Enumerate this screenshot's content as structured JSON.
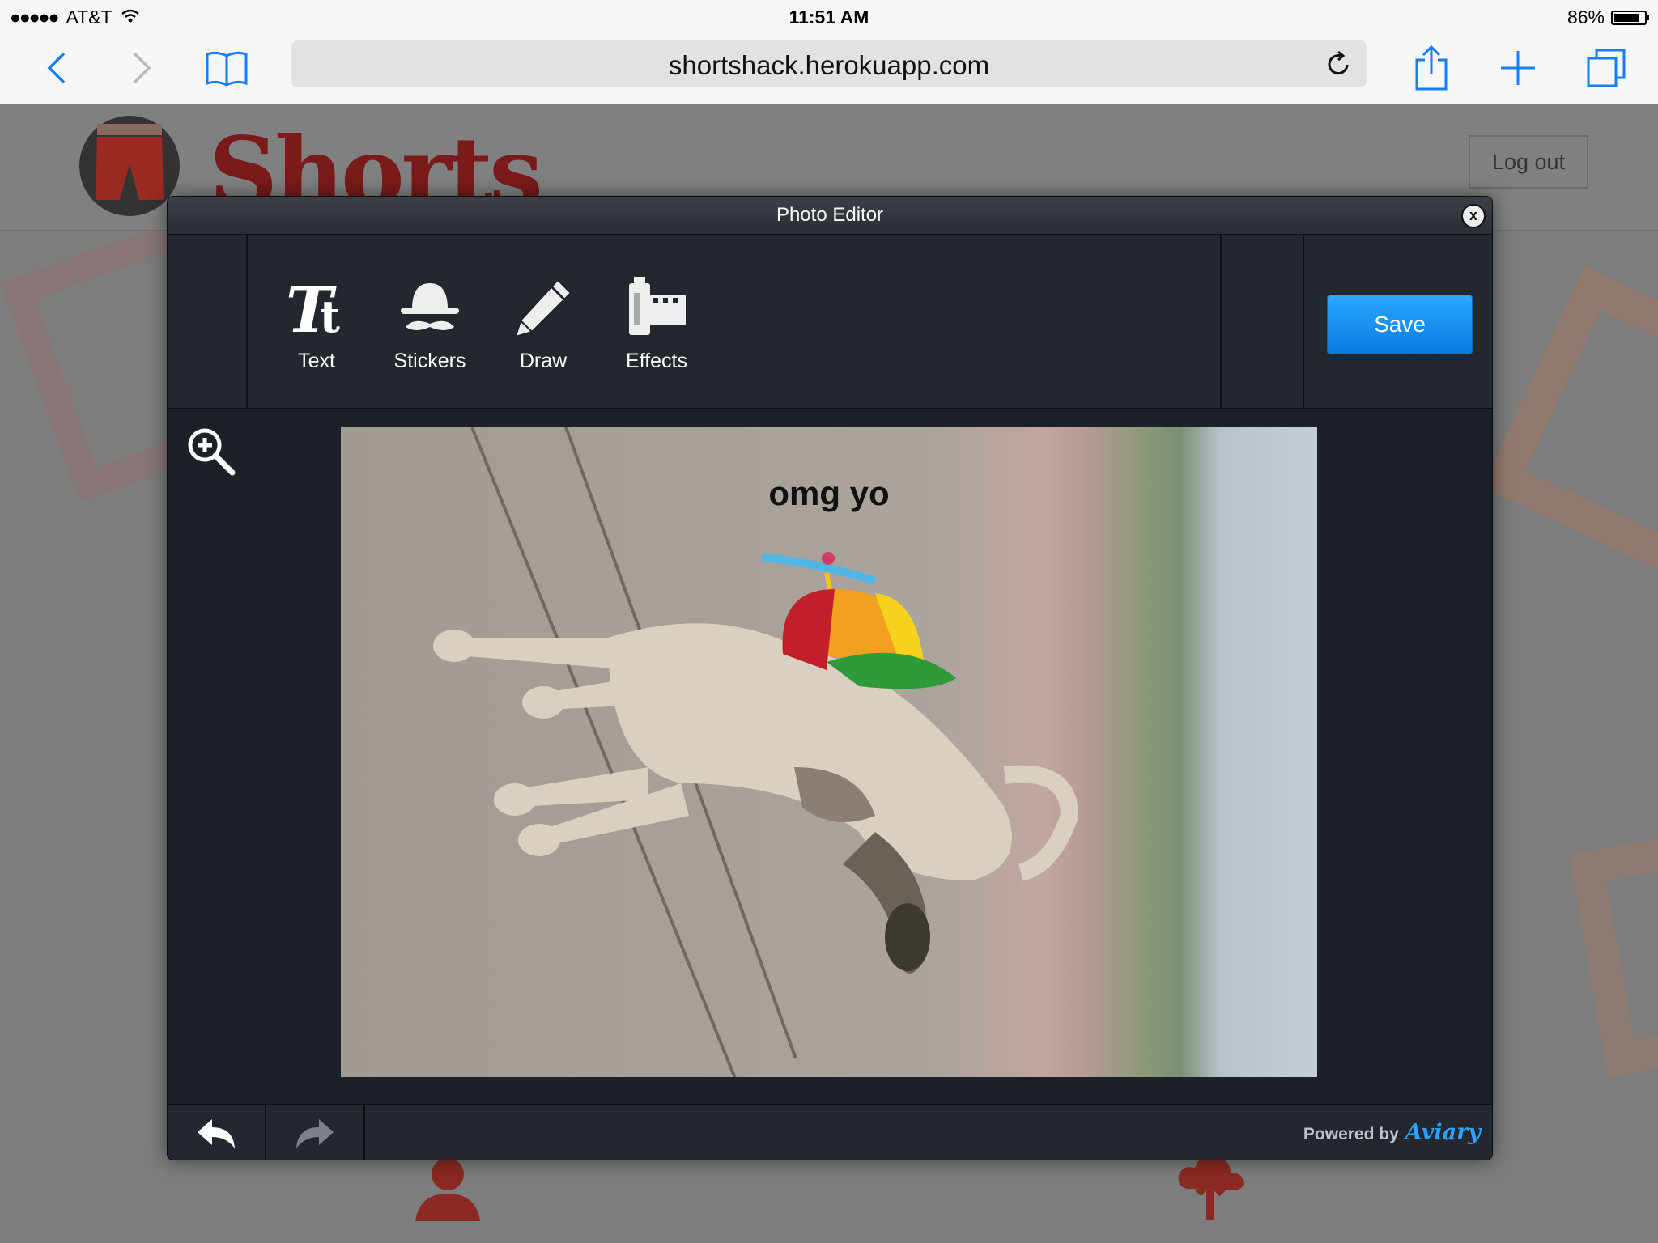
{
  "status_bar": {
    "carrier": "AT&T",
    "time": "11:51 AM",
    "battery": "86%",
    "battery_level": 0.86
  },
  "browser": {
    "url": "shortshack.herokuapp.com",
    "icons": [
      "back-icon",
      "forward-icon",
      "bookmarks-icon",
      "reload-icon",
      "share-icon",
      "new-tab-icon",
      "tabs-icon"
    ]
  },
  "site": {
    "logo_text": "Shorts",
    "logout_label": "Log out"
  },
  "editor": {
    "title": "Photo Editor",
    "close_label": "x",
    "tools": [
      {
        "label": "Text",
        "icon": "text-icon"
      },
      {
        "label": "Stickers",
        "icon": "stickers-icon"
      },
      {
        "label": "Draw",
        "icon": "pencil-icon"
      },
      {
        "label": "Effects",
        "icon": "film-icon"
      }
    ],
    "save_label": "Save",
    "photo_caption": "omg yo",
    "powered_by_label": "Powered by",
    "powered_by_brand": "Aviary"
  },
  "colors": {
    "accent": "#1591f0",
    "modal_bg": "#1d2128",
    "logo_red": "#7a1a1a"
  }
}
